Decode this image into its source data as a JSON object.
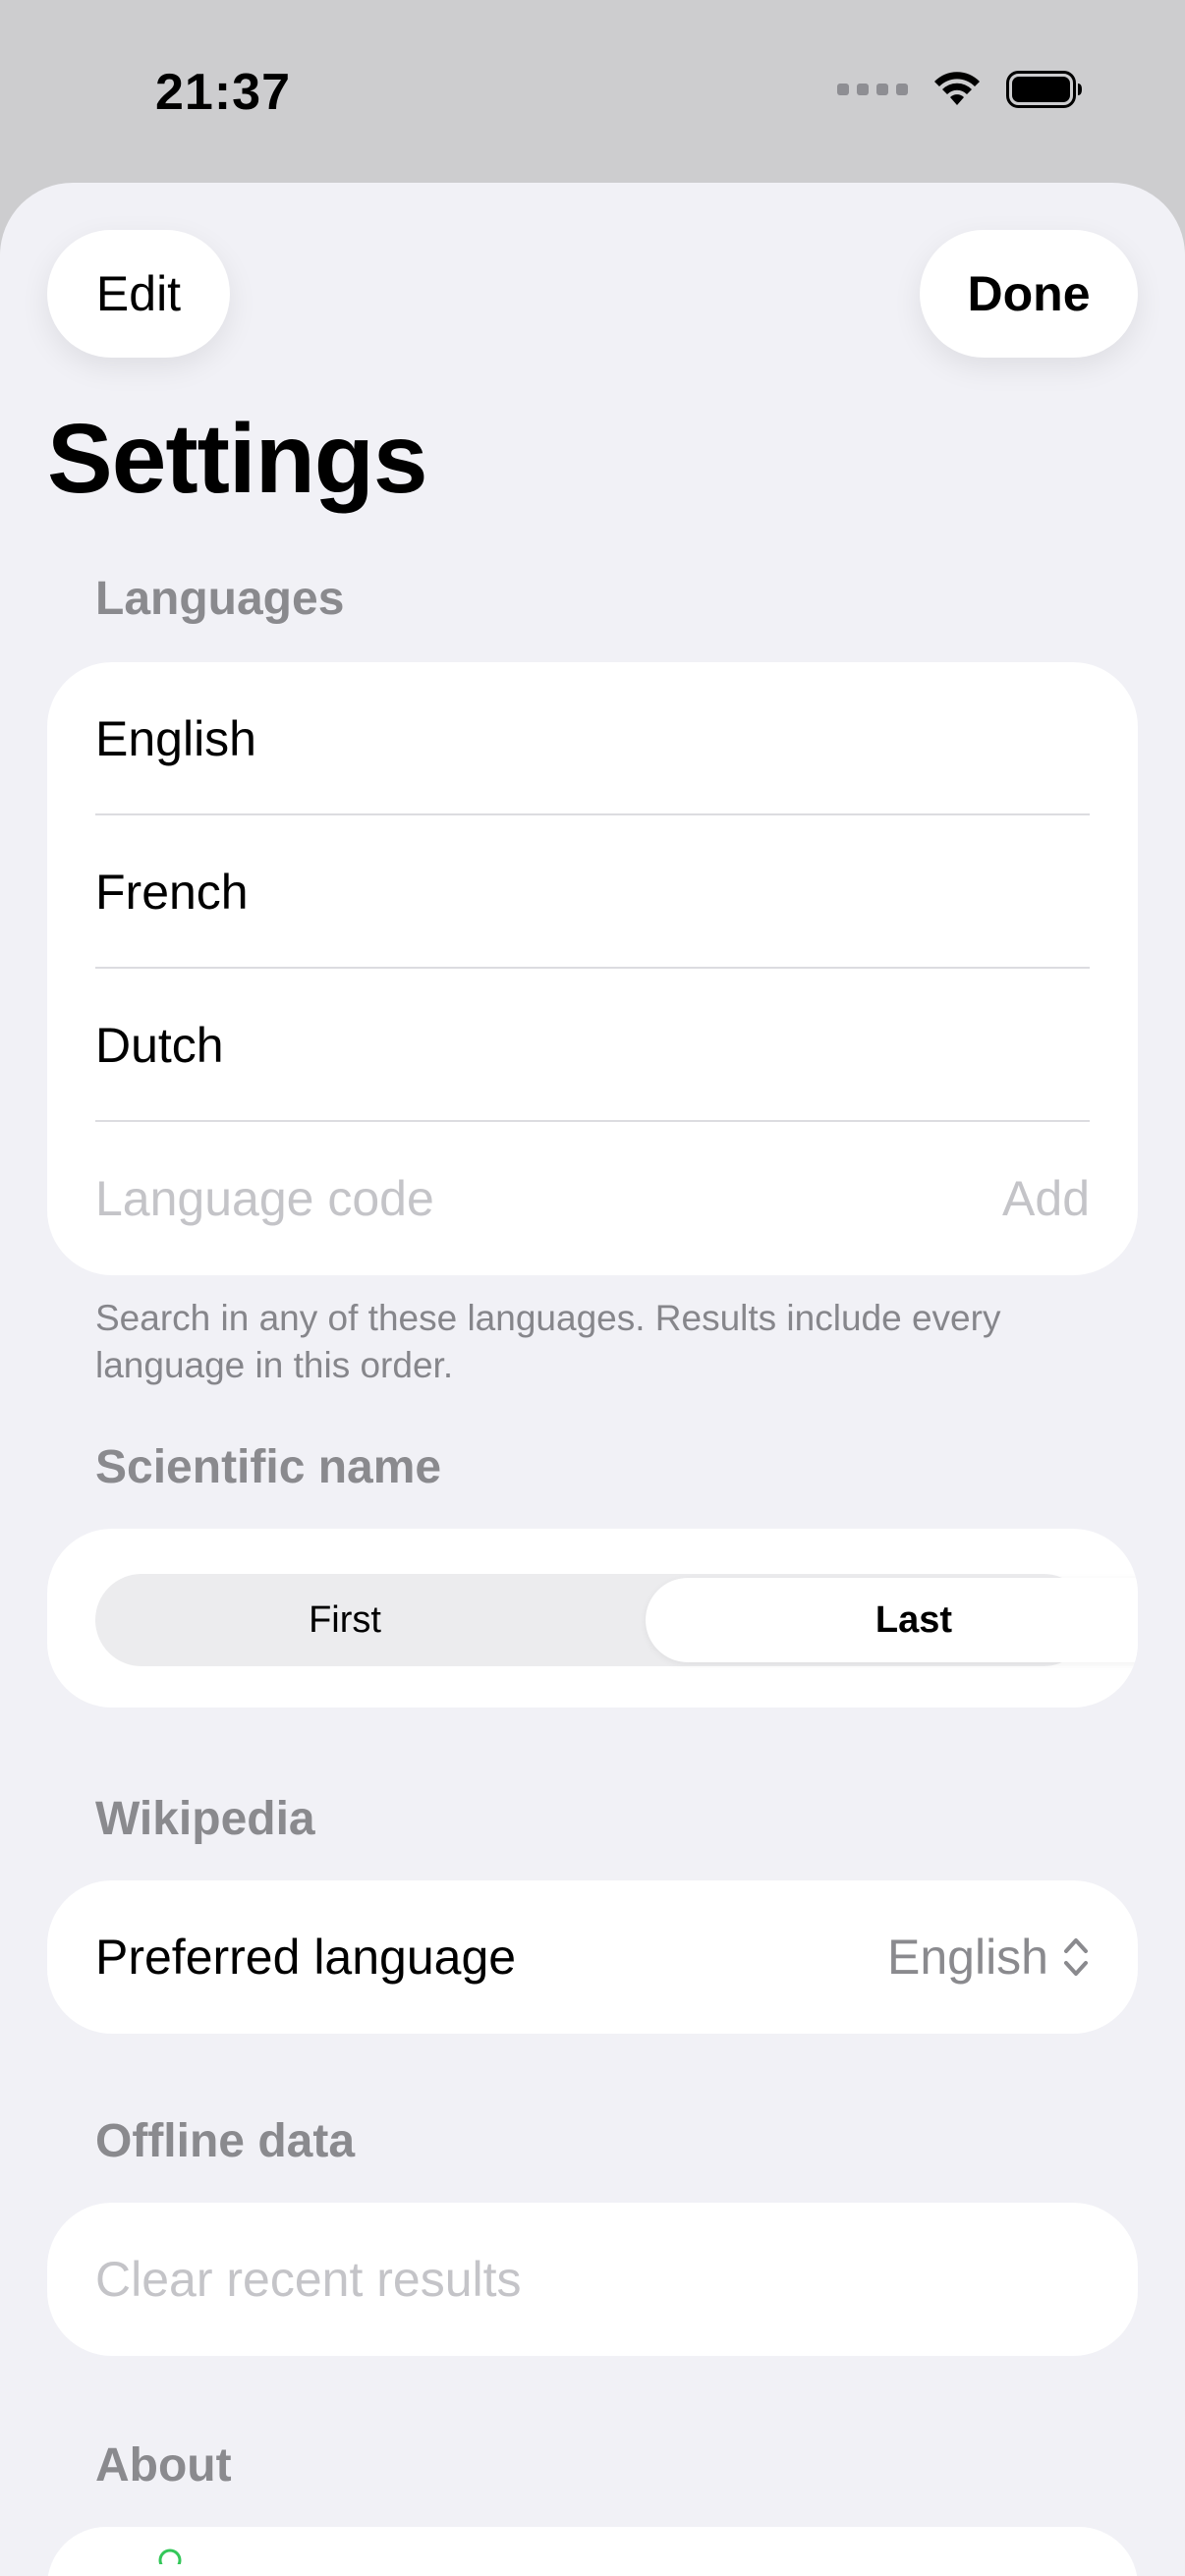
{
  "status_bar": {
    "time": "21:37"
  },
  "header": {
    "edit_label": "Edit",
    "done_label": "Done",
    "title": "Settings"
  },
  "languages": {
    "header": "Languages",
    "items": [
      "English",
      "French",
      "Dutch"
    ],
    "input_placeholder": "Language code",
    "add_label": "Add",
    "footer": "Search in any of these languages. Results include every language in this order."
  },
  "scientific_name": {
    "header": "Scientific name",
    "options": [
      "First",
      "Last"
    ],
    "selected": "Last"
  },
  "wikipedia": {
    "header": "Wikipedia",
    "preferred_language_label": "Preferred language",
    "preferred_language_value": "English"
  },
  "offline_data": {
    "header": "Offline data",
    "clear_label": "Clear recent results"
  },
  "about": {
    "header": "About"
  },
  "colors": {
    "accent": "#34c759",
    "sheet_background": "#f1f1f6",
    "secondary_text": "#8a8a8e",
    "placeholder_text": "#c4c4c8"
  }
}
